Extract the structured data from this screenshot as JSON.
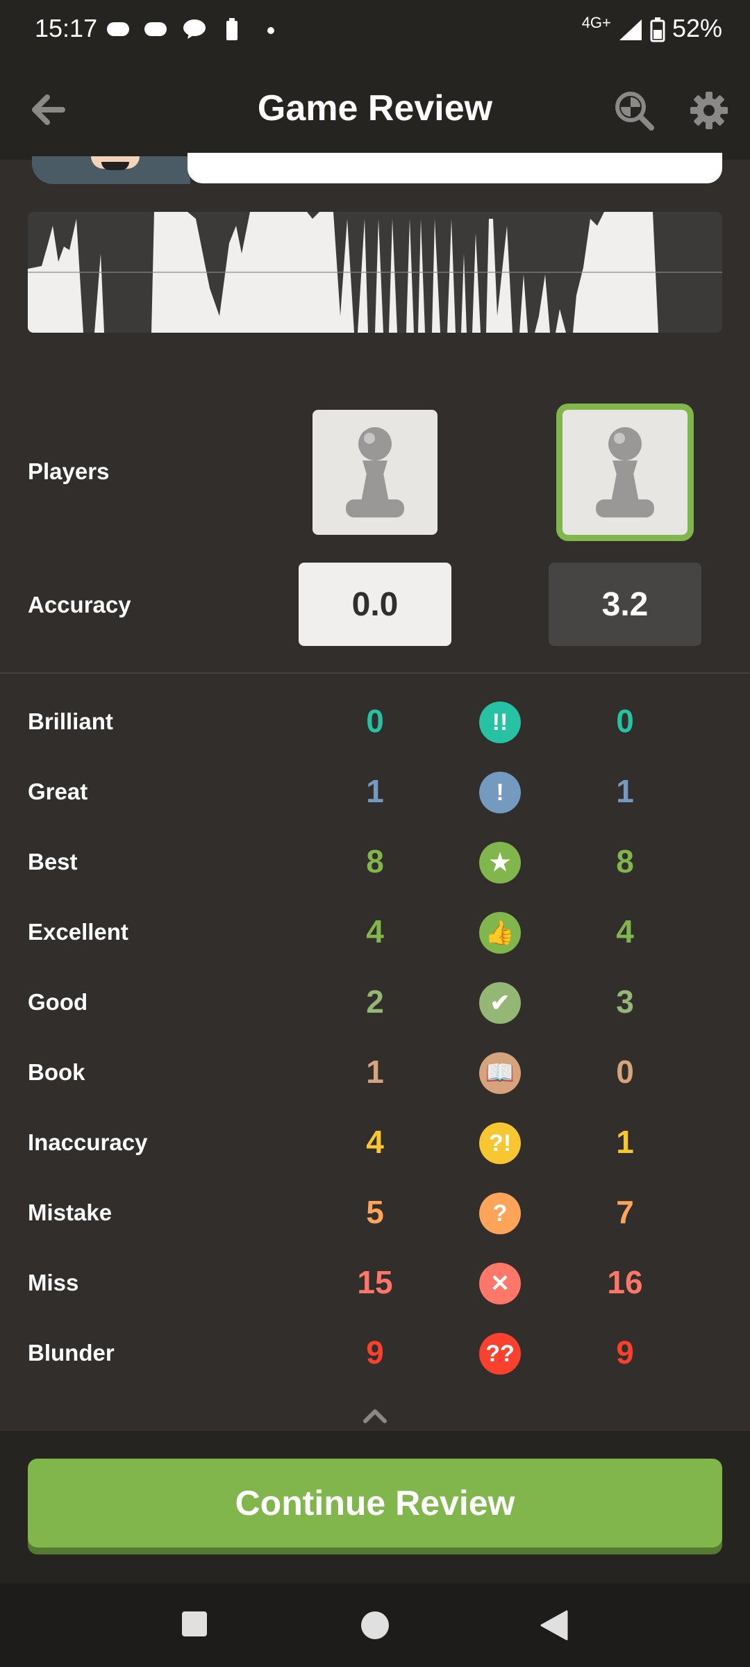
{
  "status_bar": {
    "time": "15:17",
    "network": "4G+",
    "battery": "52%"
  },
  "header": {
    "title": "Game Review"
  },
  "labels": {
    "players": "Players",
    "accuracy": "Accuracy"
  },
  "accuracy": {
    "white": "0.0",
    "black": "3.2"
  },
  "classifications": [
    {
      "label": "Brilliant",
      "white": "0",
      "black": "0",
      "color": "#26c2a3",
      "icon": "brilliant-icon",
      "symbol": "!!"
    },
    {
      "label": "Great",
      "white": "1",
      "black": "1",
      "color": "#749bbf",
      "icon": "great-icon",
      "symbol": "!"
    },
    {
      "label": "Best",
      "white": "8",
      "black": "8",
      "color": "#81b64c",
      "icon": "best-star-icon",
      "symbol": "★"
    },
    {
      "label": "Excellent",
      "white": "4",
      "black": "4",
      "color": "#81b64c",
      "icon": "excellent-thumbs-up-icon",
      "symbol": "👍"
    },
    {
      "label": "Good",
      "white": "2",
      "black": "3",
      "color": "#95b776",
      "icon": "good-check-icon",
      "symbol": "✔"
    },
    {
      "label": "Book",
      "white": "1",
      "black": "0",
      "color": "#d5a47d",
      "icon": "book-icon",
      "symbol": "📖"
    },
    {
      "label": "Inaccuracy",
      "white": "4",
      "black": "1",
      "color": "#f7c631",
      "icon": "inaccuracy-icon",
      "symbol": "?!"
    },
    {
      "label": "Mistake",
      "white": "5",
      "black": "7",
      "color": "#ffa459",
      "icon": "mistake-icon",
      "symbol": "?"
    },
    {
      "label": "Miss",
      "white": "15",
      "black": "16",
      "color": "#ff7769",
      "icon": "miss-x-icon",
      "symbol": "✕"
    },
    {
      "label": "Blunder",
      "white": "9",
      "black": "9",
      "color": "#fa412d",
      "icon": "blunder-icon",
      "symbol": "??"
    }
  ],
  "actions": {
    "continue": "Continue Review"
  }
}
